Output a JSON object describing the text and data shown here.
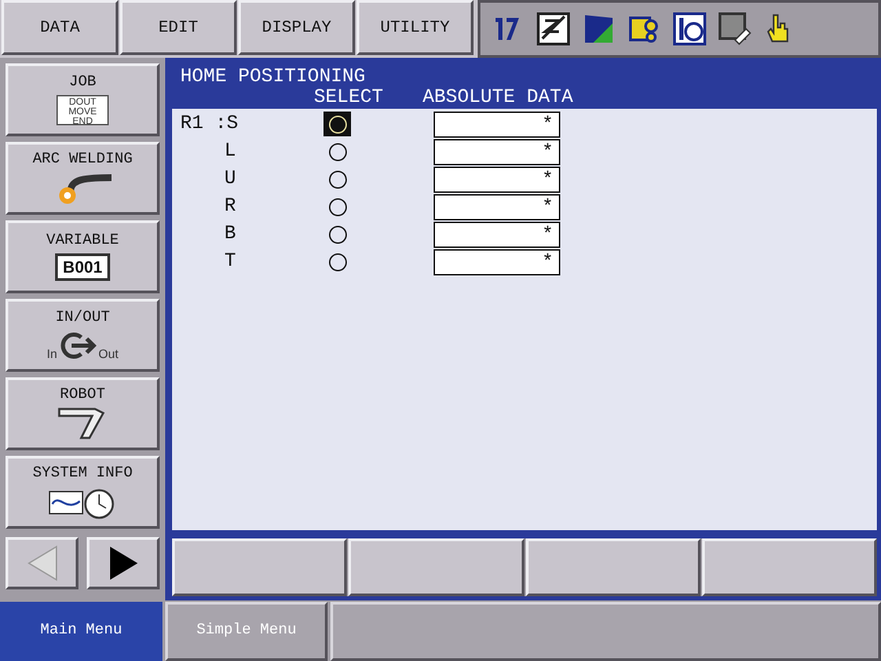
{
  "menu_bar": [
    "DATA",
    "EDIT",
    "DISPLAY",
    "UTILITY"
  ],
  "main_menu": [
    {
      "label": "JOB",
      "kind": "job",
      "icon_text": [
        "DOUT",
        "MOVE",
        "END"
      ]
    },
    {
      "label": "ARC WELDING",
      "kind": "arc"
    },
    {
      "label": "VARIABLE",
      "kind": "variable",
      "icon_text": [
        "B001"
      ]
    },
    {
      "label": "IN/OUT",
      "kind": "io",
      "icon_text": [
        "In",
        "Out"
      ]
    },
    {
      "label": "ROBOT",
      "kind": "robot"
    },
    {
      "label": "SYSTEM INFO",
      "kind": "sysinfo"
    }
  ],
  "page_arrows": {
    "back_disabled": true,
    "forward_disabled": false
  },
  "panel": {
    "title": "HOME POSITIONING",
    "columns": [
      "SELECT",
      "ABSOLUTE DATA"
    ],
    "rows": [
      {
        "axis": "R1 :S",
        "cursor": true,
        "value": "*"
      },
      {
        "axis": "L",
        "cursor": false,
        "value": "*"
      },
      {
        "axis": "U",
        "cursor": false,
        "value": "*"
      },
      {
        "axis": "R",
        "cursor": false,
        "value": "*"
      },
      {
        "axis": "B",
        "cursor": false,
        "value": "*"
      },
      {
        "axis": "T",
        "cursor": false,
        "value": "*"
      }
    ]
  },
  "bottom_tabs": [
    {
      "label": "Main Menu",
      "selected": true
    },
    {
      "label": "Simple Menu",
      "selected": false
    }
  ]
}
